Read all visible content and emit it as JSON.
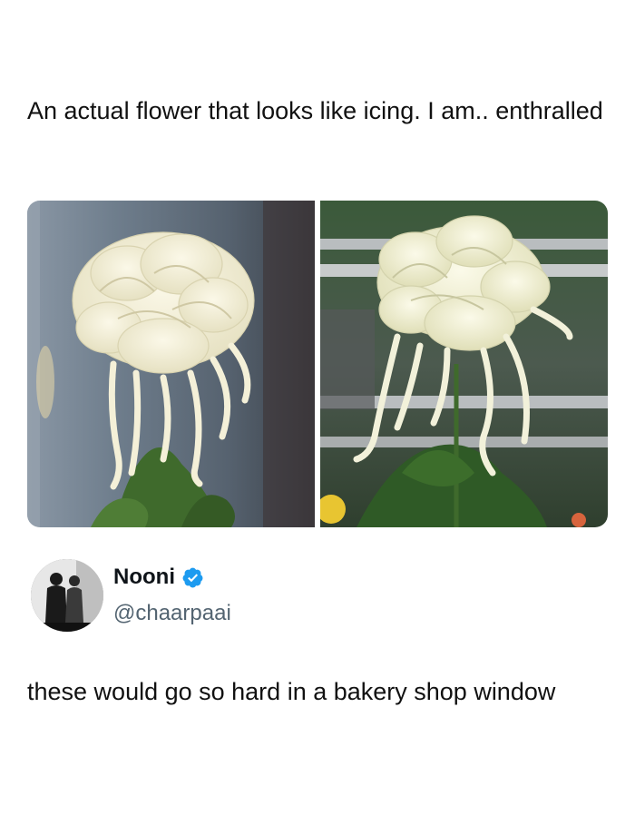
{
  "post": {
    "caption": "An actual flower that looks like icing. I am.. enthralled"
  },
  "photos": [
    {
      "icon": "flower-photo-curtain"
    },
    {
      "icon": "flower-photo-balcony"
    }
  ],
  "tweet": {
    "display_name": "Nooni",
    "handle": "@chaarpaai",
    "verified": true,
    "verified_color": "#1d9bf0",
    "text": "these would go so hard in a bakery shop window"
  },
  "colors": {
    "text": "#0f1419",
    "handle": "#536471"
  }
}
